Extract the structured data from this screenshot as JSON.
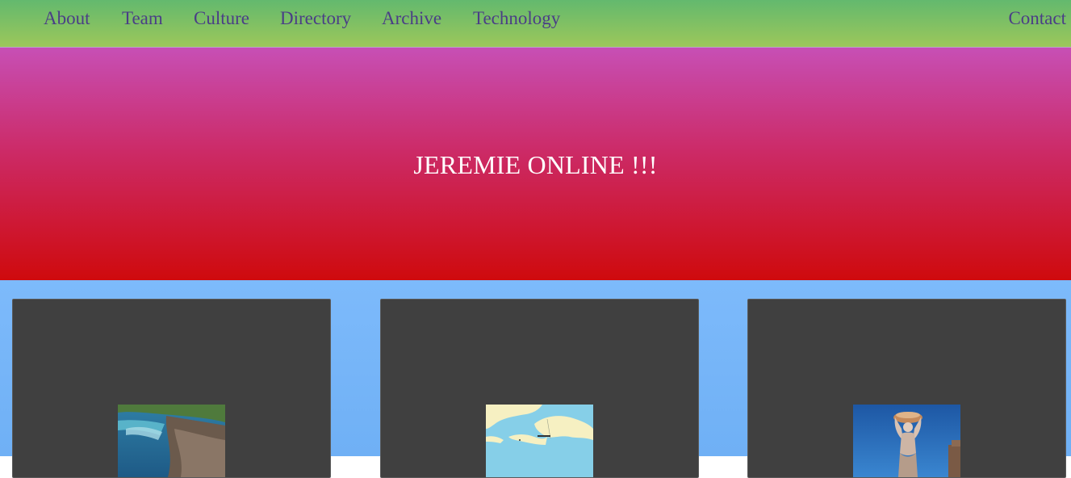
{
  "nav": {
    "items": [
      {
        "label": "About"
      },
      {
        "label": "Team"
      },
      {
        "label": "Culture"
      },
      {
        "label": "Directory"
      },
      {
        "label": "Archive"
      },
      {
        "label": "Technology"
      }
    ],
    "contact_label": "Contact"
  },
  "hero": {
    "title": "JEREMIE ONLINE !!!"
  },
  "cards": [
    {
      "image": "coastal-town-photo"
    },
    {
      "image": "haiti-map"
    },
    {
      "image": "statue-photo"
    }
  ],
  "colors": {
    "nav_text": "#4a3e86",
    "nav_gradient_top": "#63b96e",
    "nav_gradient_bottom": "#9cc75a",
    "hero_gradient_top": "#c74fb5",
    "hero_gradient_bottom": "#cf0a0d",
    "content_background": "#7dbafb",
    "card_background": "#404040"
  }
}
